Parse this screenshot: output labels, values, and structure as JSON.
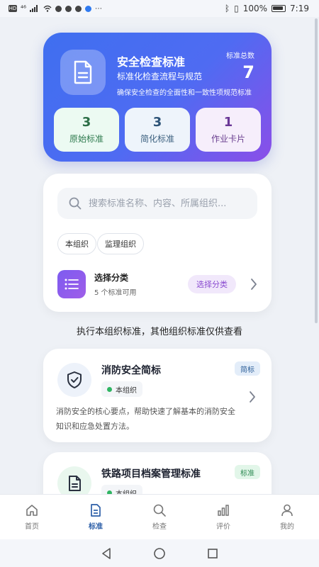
{
  "status_bar": {
    "left_text": "HD",
    "signal_text": "⁴⁶",
    "battery": "100%",
    "time": "7:19"
  },
  "hero": {
    "title": "安全检查标准",
    "subtitle": "标准化检查流程与规范",
    "description": "确保安全检查的全面性和一致性项规范标准",
    "total_label": "标准总数",
    "total_value": "7",
    "stats": [
      {
        "value": "3",
        "label": "原始标准"
      },
      {
        "value": "3",
        "label": "简化标准"
      },
      {
        "value": "1",
        "label": "作业卡片"
      }
    ]
  },
  "filter": {
    "search_placeholder": "搜索标准名称、内容、所属组织...",
    "chips": [
      "本组织",
      "监理组织"
    ],
    "category": {
      "title": "选择分类",
      "subtitle": "5 个标准可用",
      "button": "选择分类"
    }
  },
  "notice": "执行本组织标准，其他组织标准仅供查看",
  "standards": [
    {
      "title": "消防安全简标",
      "org": "本组织",
      "type": "简标",
      "description": "消防安全的核心要点，帮助快速了解基本的消防安全知识和应急处置方法。"
    },
    {
      "title": "铁路项目档案管理标准",
      "org": "本组织",
      "type": "标准",
      "description": ""
    }
  ],
  "bottom_nav": [
    {
      "label": "首页",
      "icon": "home-icon"
    },
    {
      "label": "标准",
      "icon": "document-icon"
    },
    {
      "label": "检查",
      "icon": "search-icon"
    },
    {
      "label": "评价",
      "icon": "chart-icon"
    },
    {
      "label": "我的",
      "icon": "user-icon"
    }
  ],
  "colors": {
    "hero_start": "#3f6ff0",
    "hero_end": "#8b4ee8",
    "active_nav": "#2d5fa8",
    "green_dot": "#2fb562"
  }
}
